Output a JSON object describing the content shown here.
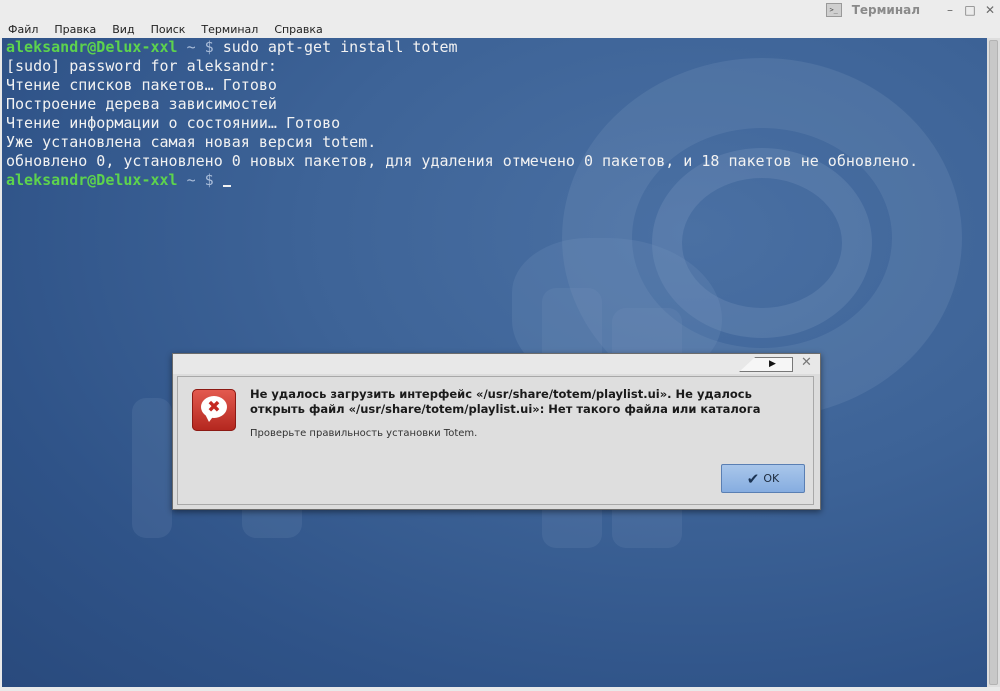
{
  "window": {
    "title": "Терминал",
    "icon": "terminal-icon",
    "buttons": {
      "minimize": "–",
      "maximize": "□",
      "close": "✕"
    }
  },
  "menubar": {
    "items": [
      "Файл",
      "Правка",
      "Вид",
      "Поиск",
      "Терминал",
      "Справка"
    ]
  },
  "terminal": {
    "user_host": "aleksandr@Delux-xxl",
    "path_prompt": " ~ $",
    "command": " sudo apt-get install totem",
    "output": [
      "[sudo] password for aleksandr:",
      "Чтение списков пакетов… Готово",
      "Построение дерева зависимостей",
      "Чтение информации о состоянии… Готово",
      "Уже установлена самая новая версия totem.",
      "обновлено 0, установлено 0 новых пакетов, для удаления отмечено 0 пакетов, и 18 пакетов не обновлено."
    ],
    "final_user_host": "aleksandr@Delux-xxl",
    "final_path_prompt": " ~ $"
  },
  "dialog": {
    "icon": "error-icon",
    "primary_line1": "Не удалось загрузить интерфейс «/usr/share/totem/playlist.ui». Не удалось",
    "primary_line2": "открыть файл «/usr/share/totem/playlist.ui»: Нет такого файла или каталога",
    "secondary": "Проверьте правильность установки Totem.",
    "ok_label": "OK",
    "close_glyph": "✕",
    "play_glyph": "▶"
  },
  "colors": {
    "prompt_user": "#5dd34d",
    "terminal_bg": "#3a5f94",
    "ok_button": "#9bbbe6"
  }
}
